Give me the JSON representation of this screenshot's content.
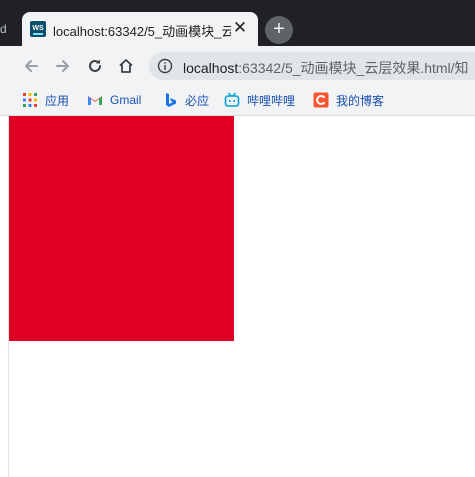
{
  "browser": {
    "left_edge_char": "d",
    "tab": {
      "title": "localhost:63342/5_动画模块_云",
      "favicon_text": "WS"
    },
    "new_tab_symbol": "+",
    "close_symbol": "✕"
  },
  "address": {
    "host": "localhost",
    "path": ":63342/5_动画模块_云层效果.html/知"
  },
  "bookmarks": [
    {
      "label": "应用",
      "icon": "apps-grid-icon"
    },
    {
      "label": "Gmail",
      "icon": "gmail-icon"
    },
    {
      "label": "必应",
      "icon": "bing-icon"
    },
    {
      "label": "哔哩哔哩",
      "icon": "bilibili-icon"
    },
    {
      "label": "我的博客",
      "icon": "csdn-icon"
    }
  ],
  "page": {
    "box_color": "#e00024"
  },
  "colors": {
    "tabstrip": "#202124",
    "toolbar": "#f1f3f4",
    "omnibox": "#e2e5e8",
    "bookmark_text": "#1a4fb0"
  }
}
